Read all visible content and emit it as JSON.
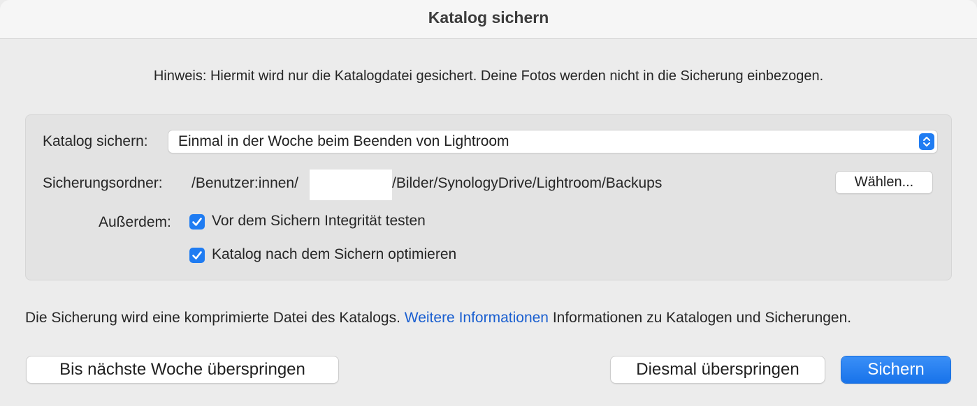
{
  "window": {
    "title": "Katalog sichern"
  },
  "notice": "Hinweis: Hiermit wird nur die Katalogdatei gesichert. Deine Fotos werden nicht in die Sicherung einbezogen.",
  "settings": {
    "backup_label": "Katalog sichern:",
    "backup_frequency": "Einmal in der Woche beim Beenden von Lightroom",
    "folder_label": "Sicherungsordner:",
    "folder_path_start": "/Benutzer:innen/",
    "folder_path_end": "/Bilder/SynologyDrive/Lightroom/Backups",
    "choose_button": "Wählen...",
    "also_label": "Außerdem:",
    "options": [
      {
        "label": "Vor dem Sichern Integrität testen",
        "checked": true
      },
      {
        "label": "Katalog nach dem Sichern optimieren",
        "checked": true
      }
    ]
  },
  "info": {
    "text_before": "Die Sicherung wird eine komprimierte Datei des Katalogs.",
    "link": "Weitere Informationen",
    "text_after": "Informationen zu Katalogen und Sicherungen."
  },
  "buttons": {
    "skip_week": "Bis nächste Woche überspringen",
    "skip_once": "Diesmal überspringen",
    "backup": "Sichern"
  },
  "colors": {
    "accent": "#1f7cf2",
    "link": "#1a5fd0",
    "background": "#ececec"
  },
  "icons": {
    "stepper": "chevron-up-down-icon",
    "checkbox": "checkmark-icon"
  }
}
